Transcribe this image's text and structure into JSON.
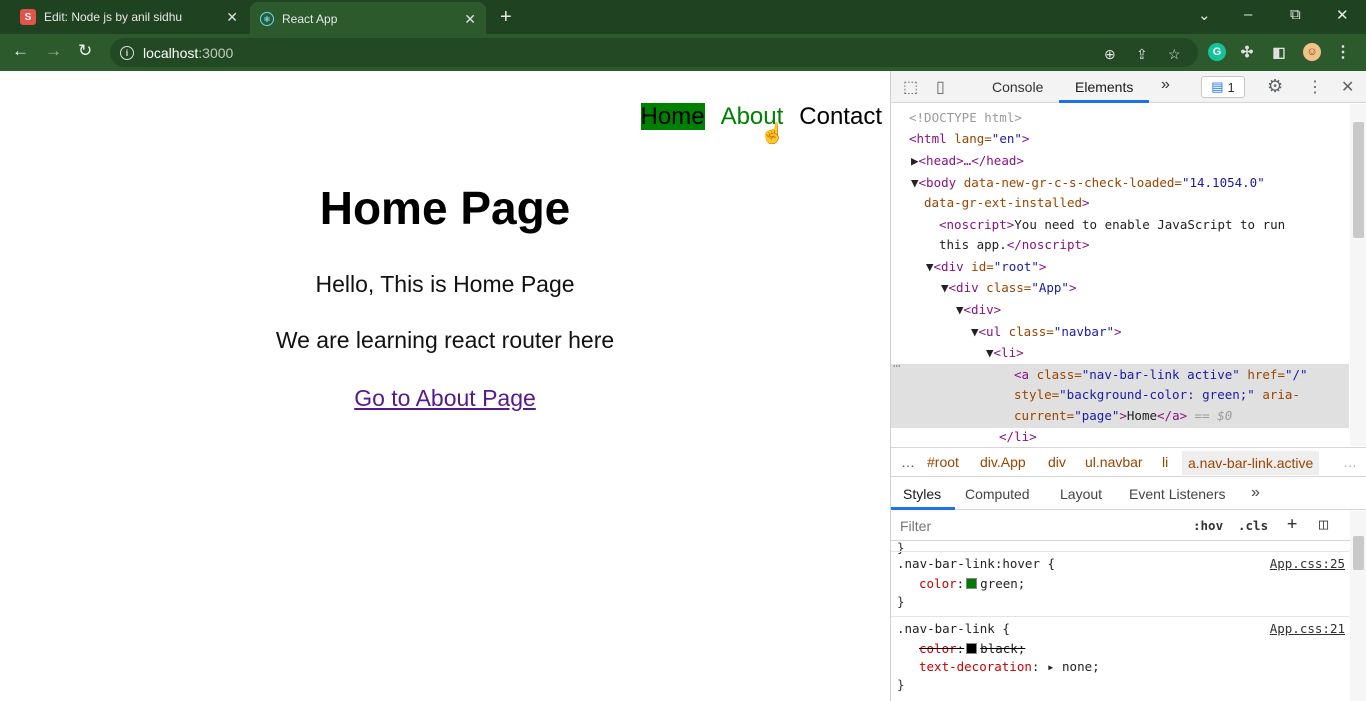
{
  "browser": {
    "tabs": [
      {
        "title": "Edit: Node js by anil sidhu",
        "favicon": "S"
      },
      {
        "title": "React App",
        "favicon": "⚛"
      }
    ],
    "new_tab": "+",
    "url_host": "localhost",
    "url_port": ":3000",
    "window_controls": {
      "dropdown": "⌄",
      "minimize": "–",
      "restore": "⧉",
      "close": "✕"
    }
  },
  "page": {
    "nav": [
      {
        "label": "Home",
        "state": "active"
      },
      {
        "label": "About",
        "state": "hover"
      },
      {
        "label": "Contact",
        "state": "normal"
      }
    ],
    "heading": "Home Page",
    "paragraph1": "Hello, This is Home Page",
    "paragraph2": "We are learning react router here",
    "link": "Go to About Page"
  },
  "devtools": {
    "tabs": {
      "console": "Console",
      "elements": "Elements",
      "more": "»"
    },
    "issues_badge": "1",
    "dom_lines": [
      {
        "doctype": "<!DOCTYPE html>"
      },
      {
        "open": "<html",
        "attr": " lang=",
        "val": "\"en\"",
        "close": ">"
      },
      {
        "text": "<head>…</head>"
      },
      {
        "open": "<body",
        "attr1": " data-new-gr-c-s-check-loaded=",
        "val1": "\"14.1054.0\""
      },
      {
        "attr2": "data-gr-ext-installed",
        "close": ">"
      },
      {
        "open": "<noscript>",
        "text": "You need to enable JavaScript to run"
      },
      {
        "text": "this app.",
        "close": "</noscript>"
      },
      {
        "open": "<div",
        "attr": " id=",
        "val": "\"root\"",
        "close": ">"
      },
      {
        "open": "<div",
        "attr": " class=",
        "val": "\"App\"",
        "close": ">"
      },
      {
        "open": "<div>"
      },
      {
        "open": "<ul",
        "attr": " class=",
        "val": "\"navbar\"",
        "close": ">"
      },
      {
        "open": "<li>"
      },
      {
        "open": "<a",
        "attr": " class=",
        "val": "\"nav-bar-link active\"",
        "attr2": " href=",
        "val2": "\"/\""
      },
      {
        "attr": "style=",
        "val": "\"background-color: green;\"",
        "attr2": " aria-"
      },
      {
        "attr": "current=",
        "val": "\"page\"",
        "close": ">",
        "text": "Home",
        "close2": "</a>",
        "eq": " == $0"
      },
      {
        "open": "</li>"
      }
    ],
    "breadcrumbs": [
      "…",
      "#root",
      "div.App",
      "div",
      "ul.navbar",
      "li",
      "a.nav-bar-link.active",
      "…"
    ],
    "style_tabs": [
      "Styles",
      "Computed",
      "Layout",
      "Event Listeners",
      "»"
    ],
    "filter_placeholder": "Filter",
    "filter_hov": ":hov",
    "filter_cls": ".cls",
    "rules": [
      {
        "selector": ".nav-bar-link:hover {",
        "source": "App.css:25",
        "decls": [
          {
            "prop": "color",
            "value": "green;",
            "swatch": "#007a00",
            "struck": false
          }
        ]
      },
      {
        "selector": ".nav-bar-link {",
        "source": "App.css:21",
        "decls": [
          {
            "prop": "color",
            "value": "black;",
            "swatch": "#000000",
            "struck": true
          },
          {
            "prop": "text-decoration",
            "value": "none;",
            "struck": false
          }
        ]
      }
    ],
    "closing_brace": "}"
  }
}
